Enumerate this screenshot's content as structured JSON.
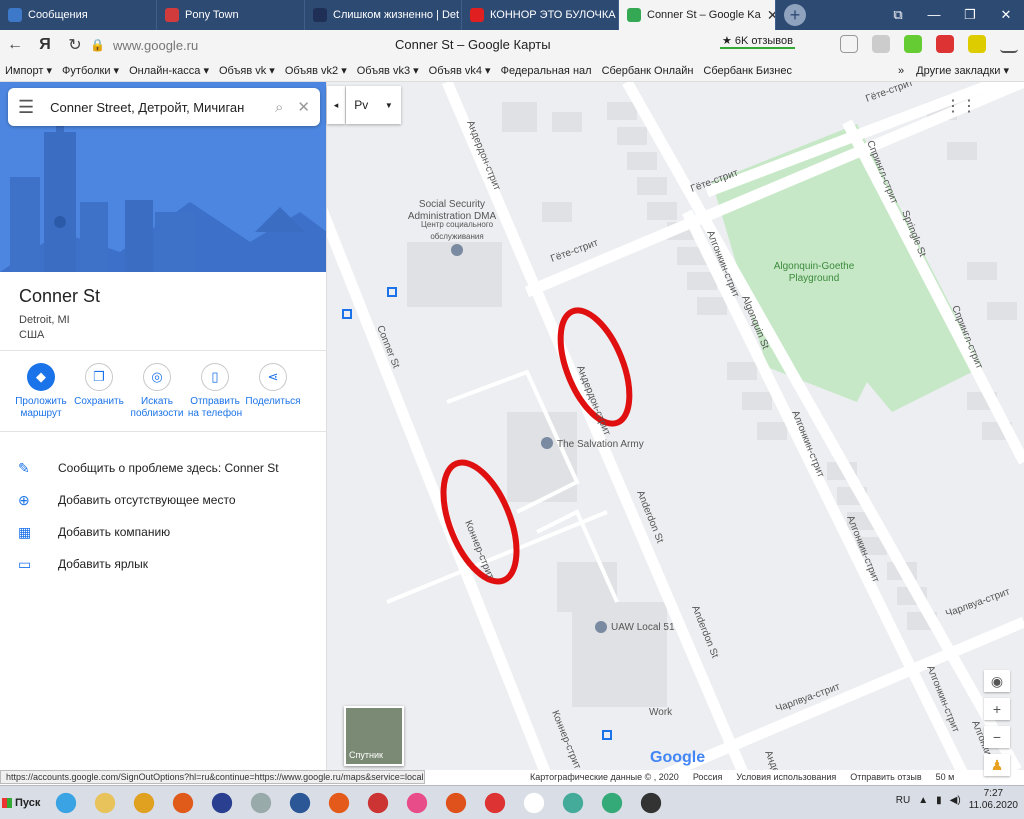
{
  "browser": {
    "tabs": [
      {
        "label": "Сообщения",
        "color": "#3d79c8"
      },
      {
        "label": "Pony Town",
        "color": "#d23b3b"
      },
      {
        "label": "Слишком жизненно | Det",
        "color": "#1f2f55"
      },
      {
        "label": "КОННОР ЭТО БУЛОЧКА (",
        "color": "#e02020"
      },
      {
        "label": "Conner St – Google Ka",
        "color": "#34a853"
      }
    ],
    "new_tab_label": "+",
    "window_controls": [
      "⧉",
      "—",
      "❐",
      "✕"
    ],
    "url": "www.google.ru",
    "page_title": "Conner St – Google Карты",
    "reviews": "★ 6K отзывов",
    "bookmarks": [
      "Импорт ▾",
      "Футболки ▾",
      "Онлайн-касса ▾",
      "Объяв vk ▾",
      "Объяв vk2 ▾",
      "Объяв vk3 ▾",
      "Объяв vk4 ▾",
      "Федеральная нал",
      "Сбербанк Онлайн",
      "Сбербанк Бизнес"
    ],
    "bookmarks_more": "»",
    "other_bookmarks": "Другие закладки ▾"
  },
  "sidebar": {
    "search_value": "Conner Street, Детройт, Мичиган",
    "place_name": "Conner St",
    "place_city": "Detroit, MI",
    "place_country": "США",
    "actions": [
      {
        "label": "Проложить маршрут",
        "icon": "directions-icon"
      },
      {
        "label": "Сохранить",
        "icon": "bookmark-icon"
      },
      {
        "label": "Искать поблизости",
        "icon": "nearby-icon"
      },
      {
        "label": "Отправить на телефон",
        "icon": "phone-icon"
      },
      {
        "label": "Поделиться",
        "icon": "share-icon"
      }
    ],
    "links": [
      {
        "label": "Сообщить о проблеме здесь: Conner St",
        "icon": "pencil-icon"
      },
      {
        "label": "Добавить отсутствующее место",
        "icon": "add-place-icon"
      },
      {
        "label": "Добавить компанию",
        "icon": "add-business-icon"
      },
      {
        "label": "Добавить ярлык",
        "icon": "label-icon"
      }
    ]
  },
  "map": {
    "layer_label": "Рv",
    "satellite_label": "Спутник",
    "logo": "Google",
    "labels": {
      "anderdon1": "Андердон-стрит",
      "gete1": "Гёте-стрит",
      "gete2": "Гёте-стрит",
      "gete3": "Гёте-стрит",
      "spring1": "Спрингл-стрит",
      "spring2": "Springle St",
      "spring3": "Спрингл-стрит",
      "algon1": "Алгонкин-стрит",
      "algon2": "Algonquin St",
      "algon3": "Алгонкин-стрит",
      "algon4": "Алгонкин-стрит",
      "algon5": "Алгонкин-стрит",
      "algon6": "Алгонкин",
      "ssa": "Social Security\nAdministration DMA",
      "ssa_ru": "Центр социального\nобслуживания",
      "park": "Algonquin-Goethe\nPlayground",
      "conner1": "Conner St",
      "anderdon2": "Андердон-стрит",
      "salvation": "The Salvation Army",
      "anderdon3": "Anderdon St",
      "conner2": "Коннер-стрит",
      "anderdon4": "Anderdon St",
      "uaw": "UAW Local 51",
      "charl1": "Чарлвуа-стрит",
      "charl2": "Чарлвуа-стрит",
      "conner3": "Коннер-стрит",
      "work": "Work",
      "andr": "Андер"
    },
    "footer": [
      "Картографические данные © , 2020",
      "Россия",
      "Условия использования",
      "Отправить отзыв",
      "50 м"
    ]
  },
  "status_url": "https://accounts.google.com/SignOutOptions?hl=ru&continue=https://www.google.ru/maps&service=local",
  "taskbar": {
    "start": "Пуск",
    "apps": [
      "#3aa3e3",
      "#e8c25a",
      "#e0a020",
      "#e05a1a",
      "#2a3f8f",
      "#9aa",
      "#2b5797",
      "#e35a1a",
      "#c33",
      "#e84d8a",
      "#e0521b",
      "#d33",
      "#fff",
      "#4a9",
      "#3a7",
      "#333"
    ],
    "lang": "RU",
    "time": "7:27",
    "date": "11.06.2020"
  },
  "colors": {
    "accent": "#1a73e8",
    "highlight_circle": "#e01010",
    "park": "#c6e8c6"
  }
}
